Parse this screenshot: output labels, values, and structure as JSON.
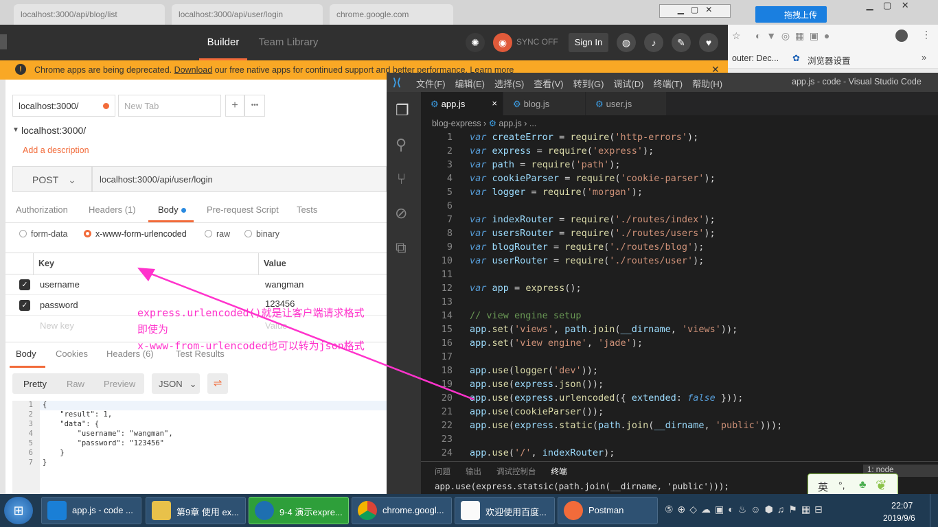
{
  "chrome": {
    "tabs": [
      "localhost:3000/api/blog/list",
      "localhost:3000/api/user/login",
      "chrome.google.com"
    ],
    "upload_btn": "拖拽上传",
    "bookmarks": [
      "outer: Dec...",
      "浏览器设置"
    ]
  },
  "postman": {
    "nav": {
      "builder": "Builder",
      "team": "Team Library"
    },
    "sync": "SYNC OFF",
    "sign_in": "Sign In",
    "banner": {
      "text": "Chrome apps are being deprecated. ",
      "link": "Download",
      "rest": " our free native apps for continued support and better performance. Learn more"
    },
    "tab1": "localhost:3000/",
    "tab2_placeholder": "New Tab",
    "plus": "+",
    "more": "•••",
    "collection": "localhost:3000/",
    "add_desc": "Add a description",
    "method": "POST",
    "url": "localhost:3000/api/user/login",
    "req_tabs": [
      "Authorization",
      "Headers (1)",
      "Body",
      "Pre-request Script",
      "Tests"
    ],
    "body_types": [
      "form-data",
      "x-www-form-urlencoded",
      "raw",
      "binary"
    ],
    "kv_headers": {
      "key": "Key",
      "value": "Value"
    },
    "rows": [
      {
        "key": "username",
        "value": "wangman"
      },
      {
        "key": "password",
        "value": "123456"
      }
    ],
    "new_key": "New key",
    "new_value": "Value",
    "resp_tabs": [
      "Body",
      "Cookies",
      "Headers (6)",
      "Test Results"
    ],
    "view_modes": [
      "Pretty",
      "Raw",
      "Preview"
    ],
    "format": "JSON",
    "response": [
      {
        "n": "1",
        "t": "{"
      },
      {
        "n": "2",
        "t": "    \"result\": 1,"
      },
      {
        "n": "3",
        "t": "    \"data\": {"
      },
      {
        "n": "4",
        "t": "        \"username\": \"wangman\","
      },
      {
        "n": "5",
        "t": "        \"password\": \"123456\""
      },
      {
        "n": "6",
        "t": "    }"
      },
      {
        "n": "7",
        "t": "}"
      }
    ]
  },
  "annotation": [
    "express.urlencoded()就是让客户端请求格式",
    "即使为",
    "x-www-from-urlencoded也可以转为json格式"
  ],
  "vscode": {
    "menu": [
      "文件(F)",
      "编辑(E)",
      "选择(S)",
      "查看(V)",
      "转到(G)",
      "调试(D)",
      "终端(T)",
      "帮助(H)"
    ],
    "title": "app.js - code - Visual Studio Code",
    "tabs": [
      "app.js",
      "blog.js",
      "user.js"
    ],
    "close": "×",
    "breadcrumb": [
      "blog-express",
      "app.js",
      "..."
    ],
    "panel_tabs": [
      "问题",
      "输出",
      "调试控制台",
      "终端"
    ],
    "terminal_select": "1: node",
    "terminal_line": "app.use(express.statsic(path.join(__dirname, 'public')));"
  },
  "ime": {
    "label": "英",
    "punct": "°,"
  },
  "taskbar": {
    "items": [
      "app.js - code ...",
      "第9章 使用 ex...",
      "9-4 演示expre...",
      "chrome.googl...",
      "欢迎使用百度...",
      "Postman"
    ],
    "time": "22:07",
    "date": "2019/9/6"
  },
  "colors": {
    "accent": "#f26b3a",
    "banner": "#f9a825",
    "vscode_bg": "#1e1e1e",
    "annotation": "#ff33cc"
  }
}
